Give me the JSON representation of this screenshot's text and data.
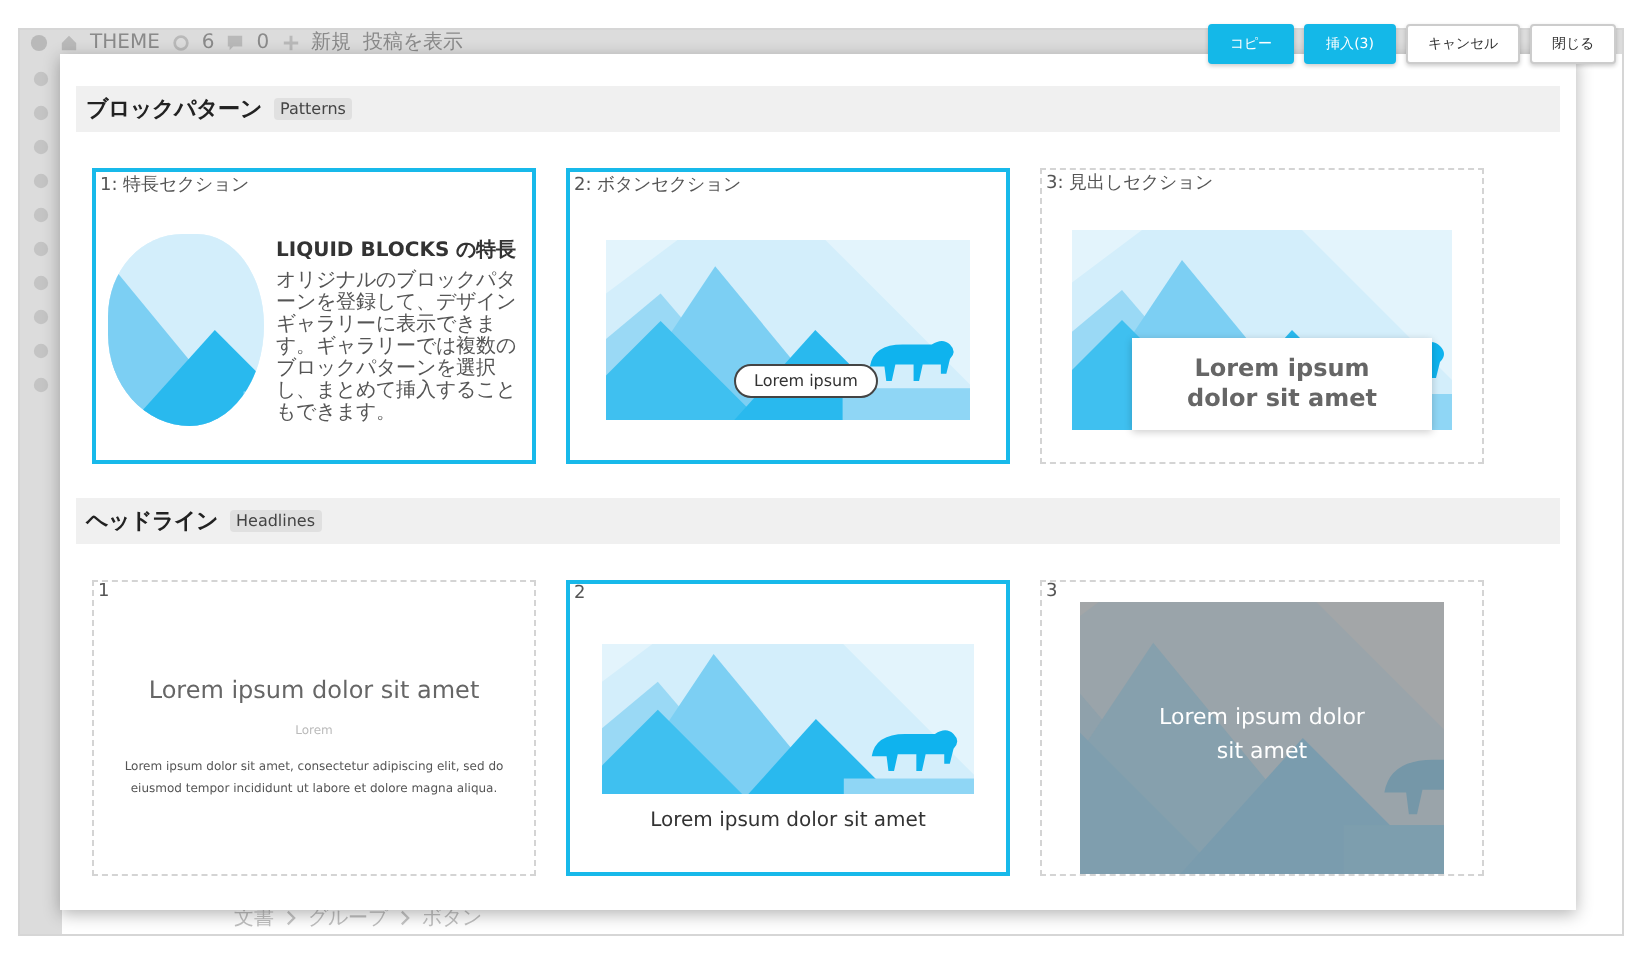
{
  "admin_bar": {
    "site": "THEME",
    "updates": "6",
    "comments": "0",
    "new": "新規",
    "view": "投稿を表示"
  },
  "actions": [
    {
      "label": "コピー",
      "kind": "primary"
    },
    {
      "label": "挿入(3)",
      "kind": "primary"
    },
    {
      "label": "キャンセル",
      "kind": "secondary"
    },
    {
      "label": "閉じる",
      "kind": "secondary"
    }
  ],
  "sections": [
    {
      "title": "ブロックパターン",
      "tag": "Patterns",
      "patterns": [
        {
          "label": "1: 特長セクション",
          "selected": true,
          "kind": "feature",
          "heading": "LIQUID BLOCKS の特長",
          "text": "オリジナルのブロックパターンを登録して、デザインギャラリーに表示できます。ギャラリーでは複数のブロックパターンを選択し、まとめて挿入することもできます。"
        },
        {
          "label": "2: ボタンセクション",
          "selected": true,
          "kind": "button",
          "button": "Lorem ipsum"
        },
        {
          "label": "3: 見出しセクション",
          "selected": false,
          "kind": "heading-box",
          "heading": "Lorem ipsum dolor sit amet"
        }
      ]
    },
    {
      "title": "ヘッドライン",
      "tag": "Headlines",
      "patterns": [
        {
          "label": "1",
          "selected": false,
          "kind": "text",
          "heading": "Lorem ipsum dolor sit amet",
          "subheading": "Lorem",
          "text": "Lorem ipsum dolor sit amet, consectetur adipiscing elit, sed do eiusmod tempor incididunt ut labore et dolore magna aliqua."
        },
        {
          "label": "2",
          "selected": true,
          "kind": "caption",
          "heading": "Lorem ipsum dolor sit amet"
        },
        {
          "label": "3",
          "selected": false,
          "kind": "overlay",
          "heading": "Lorem ipsum dolor sit amet"
        }
      ]
    }
  ],
  "breadcrumb": [
    "文書",
    "グループ",
    "ボタン"
  ]
}
